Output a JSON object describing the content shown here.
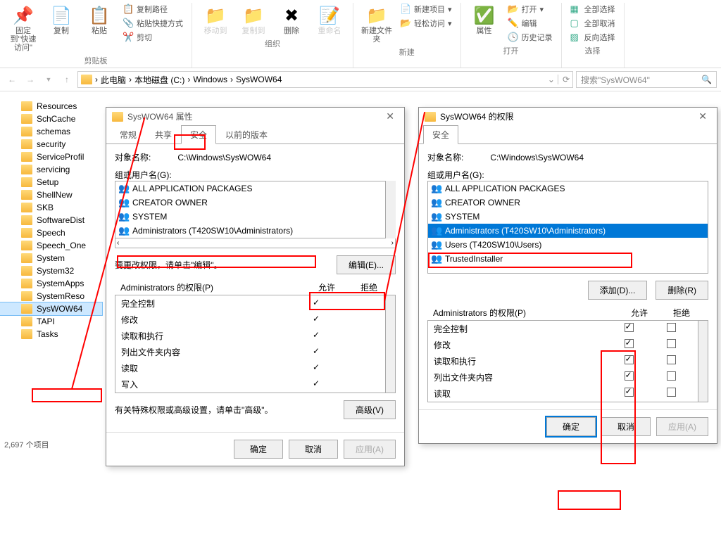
{
  "ribbon": {
    "pin_label": "固定到\"快速访问\"",
    "copy_label": "复制",
    "paste_label": "粘贴",
    "copy_path": "复制路径",
    "paste_shortcut": "粘贴快捷方式",
    "cut": "剪切",
    "clipboard_group": "剪贴板",
    "move_to": "移动到",
    "copy_to": "复制到",
    "delete": "删除",
    "rename": "重命名",
    "organize_group": "组织",
    "new_folder": "新建文件夹",
    "new_item": "新建项目",
    "easy_access": "轻松访问",
    "new_group": "新建",
    "properties": "属性",
    "open": "打开",
    "edit": "编辑",
    "history": "历史记录",
    "open_group": "打开",
    "select_all": "全部选择",
    "select_none": "全部取消",
    "invert": "反向选择",
    "select_group": "选择"
  },
  "breadcrumb": {
    "parts": [
      "此电脑",
      "本地磁盘 (C:)",
      "Windows",
      "SysWOW64"
    ]
  },
  "search_placeholder": "搜索\"SysWOW64\"",
  "folders": [
    "Resources",
    "SchCache",
    "schemas",
    "security",
    "ServiceProfil",
    "servicing",
    "Setup",
    "ShellNew",
    "SKB",
    "SoftwareDist",
    "Speech",
    "Speech_One",
    "System",
    "System32",
    "SystemApps",
    "SystemReso",
    "SysWOW64",
    "TAPI",
    "Tasks"
  ],
  "status_text": "2,697 个项目",
  "dialog1": {
    "title": "SysWOW64 属性",
    "tabs": {
      "general": "常规",
      "share": "共享",
      "security": "安全",
      "prev": "以前的版本"
    },
    "object_label": "对象名称:",
    "object_path": "C:\\Windows\\SysWOW64",
    "groups_label": "组或用户名(G):",
    "groups": [
      "ALL APPLICATION PACKAGES",
      "CREATOR OWNER",
      "SYSTEM",
      "Administrators (T420SW10\\Administrators)"
    ],
    "edit_hint": "要更改权限，请单击\"编辑\"。",
    "edit_btn": "编辑(E)...",
    "perms_label": "Administrators 的权限(P)",
    "allow": "允许",
    "deny": "拒绝",
    "perms": [
      "完全控制",
      "修改",
      "读取和执行",
      "列出文件夹内容",
      "读取",
      "写入"
    ],
    "advanced_hint": "有关特殊权限或高级设置，请单击\"高级\"。",
    "advanced_btn": "高级(V)",
    "ok": "确定",
    "cancel": "取消",
    "apply": "应用(A)"
  },
  "dialog2": {
    "title": "SysWOW64 的权限",
    "tab": "安全",
    "object_label": "对象名称:",
    "object_path": "C:\\Windows\\SysWOW64",
    "groups_label": "组或用户名(G):",
    "groups": [
      "ALL APPLICATION PACKAGES",
      "CREATOR OWNER",
      "SYSTEM",
      "Administrators (T420SW10\\Administrators)",
      "Users (T420SW10\\Users)",
      "TrustedInstaller"
    ],
    "add_btn": "添加(D)...",
    "remove_btn": "删除(R)",
    "perms_label": "Administrators 的权限(P)",
    "allow": "允许",
    "deny": "拒绝",
    "perms": [
      "完全控制",
      "修改",
      "读取和执行",
      "列出文件夹内容",
      "读取"
    ],
    "ok": "确定",
    "cancel": "取消",
    "apply": "应用(A)"
  }
}
